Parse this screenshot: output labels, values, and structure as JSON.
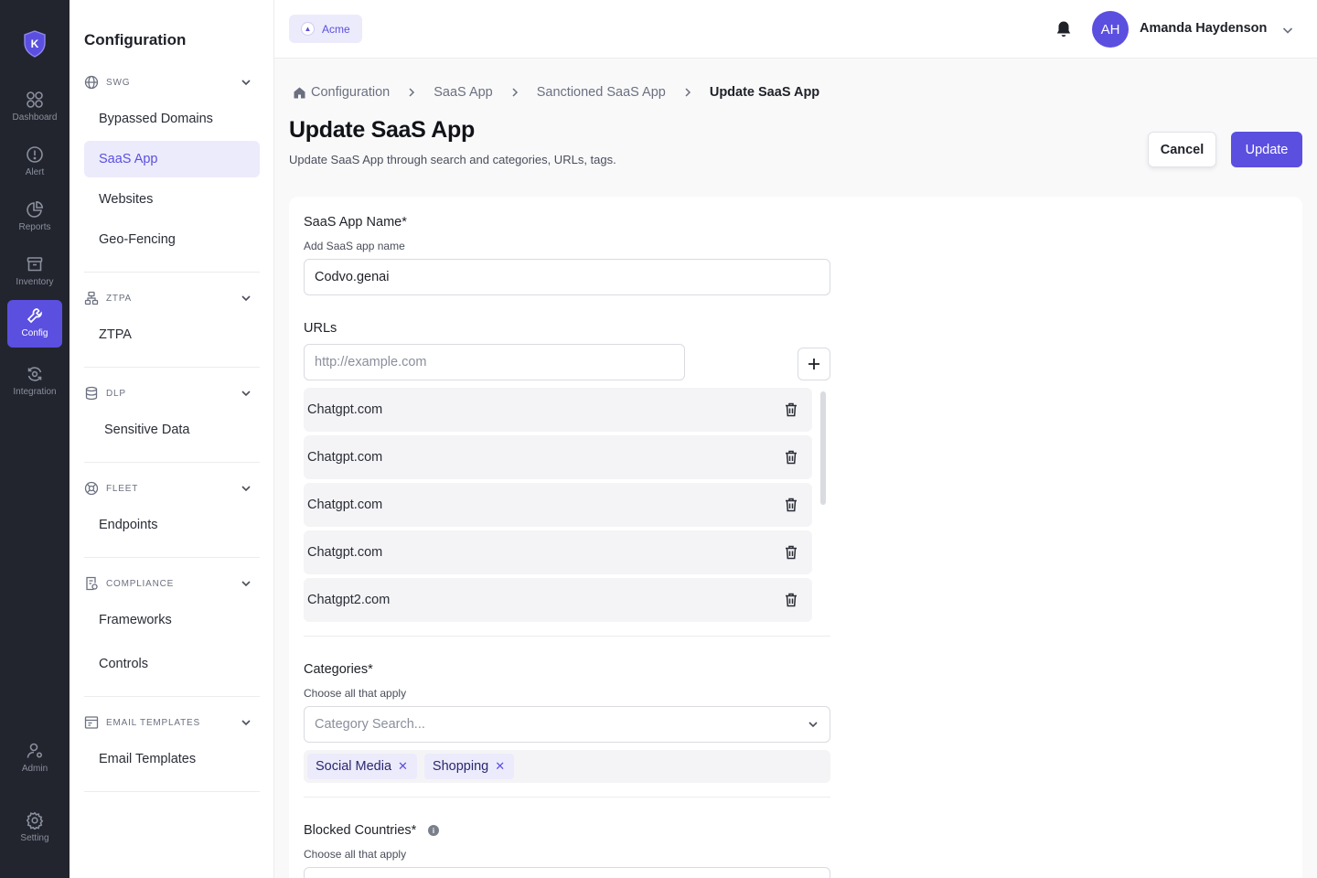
{
  "nav": {
    "items": [
      {
        "label": "Dashboard",
        "icon": "dashboard-icon"
      },
      {
        "label": "Alert",
        "icon": "alert-icon"
      },
      {
        "label": "Reports",
        "icon": "reports-icon"
      },
      {
        "label": "Inventory",
        "icon": "inventory-icon"
      },
      {
        "label": "Config",
        "icon": "wrench-icon",
        "active": true
      },
      {
        "label": "Integration",
        "icon": "integration-icon"
      }
    ],
    "bottom": [
      {
        "label": "Admin",
        "icon": "admin-icon"
      },
      {
        "label": "Setting",
        "icon": "gear-icon"
      }
    ]
  },
  "sidebar": {
    "title": "Configuration",
    "groups": [
      {
        "name": "SWG",
        "icon": "globe-icon",
        "items": [
          "Bypassed Domains",
          "SaaS App",
          "Websites",
          "Geo-Fencing"
        ]
      },
      {
        "name": "ZTPA",
        "icon": "network-icon",
        "items": [
          "ZTPA"
        ]
      },
      {
        "name": "DLP",
        "icon": "database-icon",
        "items": [
          "Sensitive Data"
        ]
      },
      {
        "name": "FLEET",
        "icon": "fleet-icon",
        "items": [
          "Endpoints"
        ]
      },
      {
        "name": "COMPLIANCE",
        "icon": "compliance-icon",
        "items": [
          "Frameworks",
          "Controls"
        ]
      },
      {
        "name": "EMAIL TEMPLATES",
        "icon": "email-template-icon",
        "items": [
          "Email Templates"
        ]
      }
    ]
  },
  "topbar": {
    "org": "Acme",
    "user_initials": "AH",
    "user_name": "Amanda Haydenson"
  },
  "breadcrumb": [
    "Configuration",
    "SaaS App",
    "Sanctioned SaaS App",
    "Update SaaS App"
  ],
  "header": {
    "title": "Update SaaS App",
    "subtitle": "Update SaaS App through search and categories, URLs, tags.",
    "cancel_label": "Cancel",
    "update_label": "Update"
  },
  "form": {
    "name_label": "SaaS App Name*",
    "name_help": "Add SaaS app name",
    "name_value": "Codvo.genai",
    "urls_label": "URLs",
    "url_placeholder": "http://example.com",
    "urls": [
      "Chatgpt.com",
      "Chatgpt.com",
      "Chatgpt.com",
      "Chatgpt.com",
      "Chatgpt2.com"
    ],
    "categories_label": "Categories*",
    "categories_help": "Choose all that apply",
    "categories_placeholder": "Category Search...",
    "categories_selected": [
      "Social Media",
      "Shopping"
    ],
    "blocked_label": "Blocked Countries*",
    "blocked_help": "Choose all that apply"
  },
  "colors": {
    "accent": "#5b4fe0",
    "rail_bg": "#22252e",
    "accent_soft": "#ecebfb"
  }
}
